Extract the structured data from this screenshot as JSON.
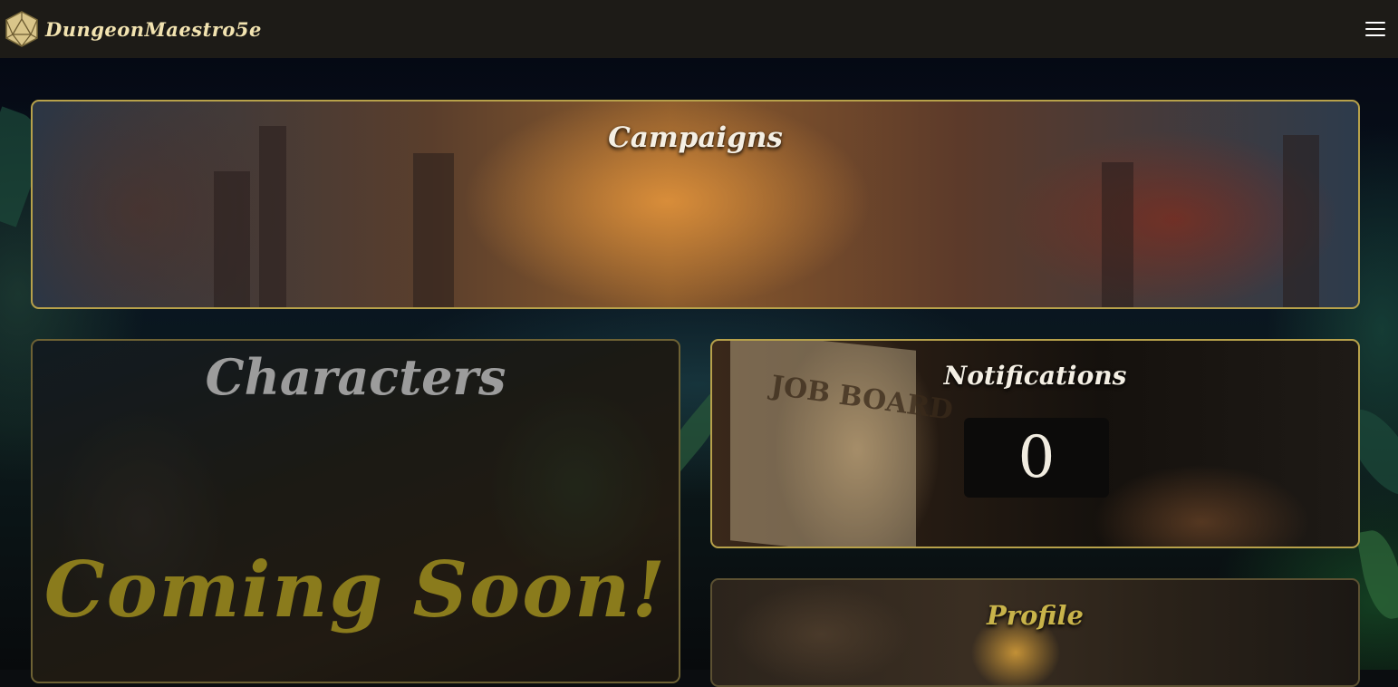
{
  "app": {
    "brand_name": "DungeonMaestro5e",
    "logo_icon": "d20-icon",
    "menu_icon": "hamburger-menu-icon"
  },
  "cards": {
    "campaigns": {
      "title": "Campaigns"
    },
    "characters": {
      "title": "Characters",
      "overlay": "Coming Soon!"
    },
    "notifications": {
      "title": "Notifications",
      "count": "0",
      "image_text": "JOB BOARD"
    },
    "profile": {
      "title": "Profile"
    }
  },
  "colors": {
    "accent_border": "#b7a14a",
    "header_bg": "#1d1b17",
    "coming_soon": "#8a7b1c"
  }
}
